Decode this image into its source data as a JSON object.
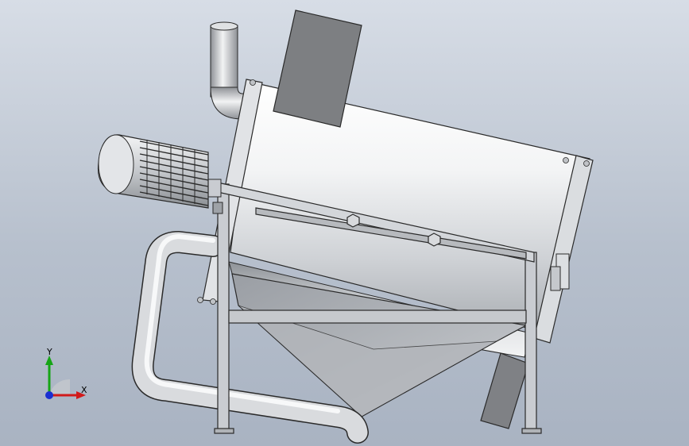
{
  "viewport": {
    "background_top": "#d7dde6",
    "background_bottom": "#a9b3c2"
  },
  "model": {
    "body_color": "#e9ecef",
    "frame_color": "#c9ccd1",
    "hopper_color": "#a9adb3",
    "panel_color": "#7d7f82",
    "edge_color": "#2a2a2a"
  },
  "triad": {
    "x_label": "X",
    "y_label": "Y",
    "x_color": "#d11a1a",
    "y_color": "#16a516",
    "z_color": "#1a2fd1"
  }
}
